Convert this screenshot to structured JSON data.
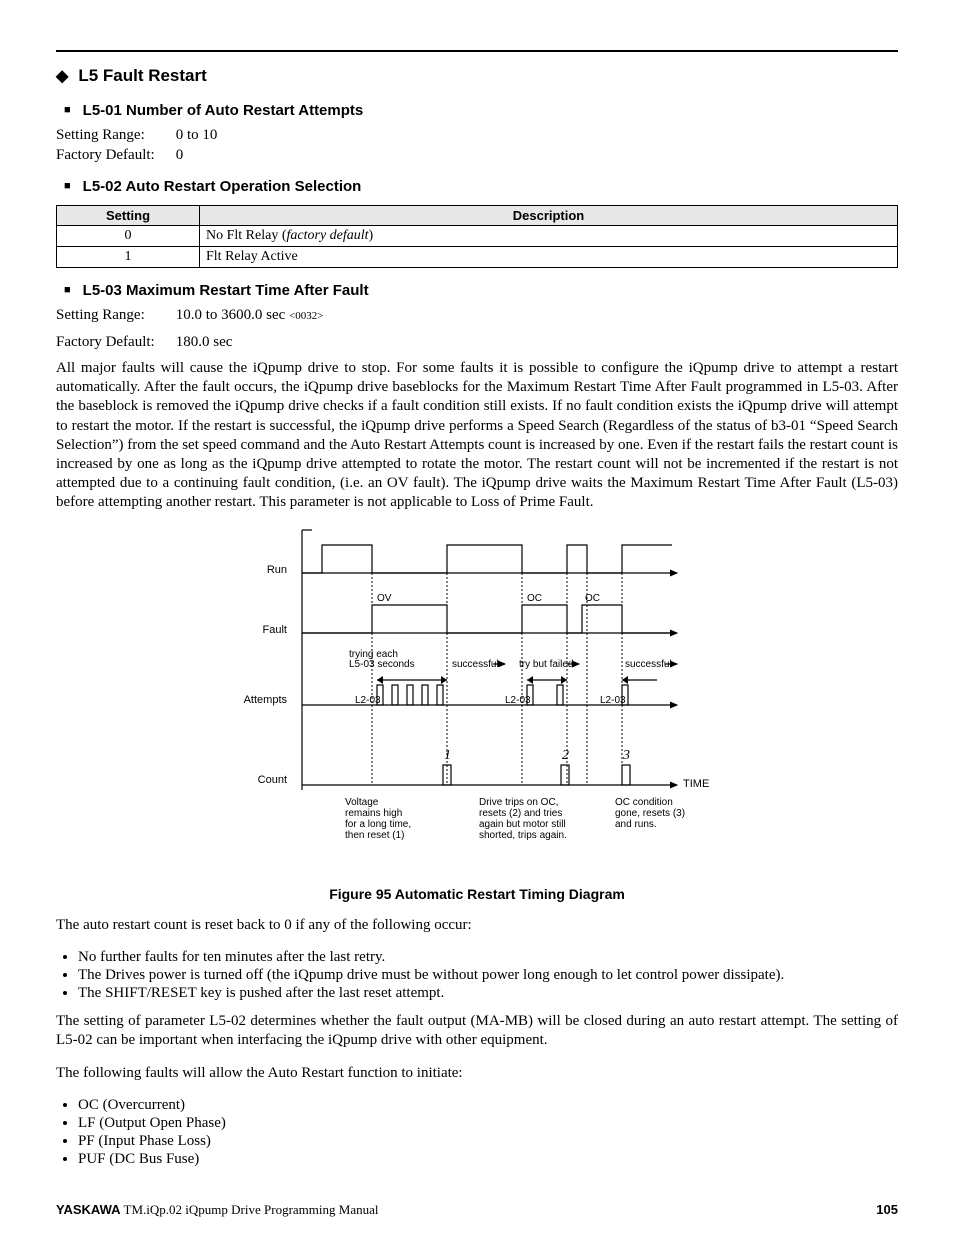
{
  "section_title": "L5 Fault Restart",
  "subsections": {
    "l5_01": {
      "title": "L5-01 Number of Auto Restart Attempts",
      "setting_range_label": "Setting Range:",
      "setting_range_value": "0 to 10",
      "factory_default_label": "Factory Default:",
      "factory_default_value": "0"
    },
    "l5_02": {
      "title": "L5-02 Auto Restart Operation Selection",
      "table": {
        "header": {
          "setting": "Setting",
          "description": "Description"
        },
        "rows": [
          {
            "setting": "0",
            "description": "No Flt Relay (factory default)",
            "desc_prefix": "No Flt Relay (",
            "desc_italic": "factory default",
            "desc_suffix": ")"
          },
          {
            "setting": "1",
            "description": "Flt Relay Active"
          }
        ]
      }
    },
    "l5_03": {
      "title": "L5-03 Maximum Restart Time After Fault",
      "setting_range_label": "Setting Range:",
      "setting_range_value": "10.0 to 3600.0 sec ",
      "setting_range_code": "<0032>",
      "factory_default_label": "Factory Default:",
      "factory_default_value": "180.0 sec",
      "paragraph": "All major faults will cause the iQpump drive to stop. For some faults it is possible to configure the iQpump drive to attempt a restart automatically. After the fault occurs, the iQpump drive baseblocks for the Maximum Restart Time After Fault programmed in L5-03. After the baseblock is removed the iQpump drive checks if a fault condition still exists. If no fault condition exists the iQpump drive will attempt to restart the motor. If the restart is successful, the iQpump drive performs a Speed Search (Regardless of the status of b3-01 “Speed Search Selection”) from the set speed command and the Auto Restart Attempts count is increased by one. Even if the restart fails the restart count is increased by one as long as the iQpump drive attempted to rotate the motor. The restart count will not be incremented if the restart is not attempted due to a continuing fault condition, (i.e. an OV fault). The iQpump drive waits the Maximum Restart Time After Fault (L5-03) before attempting another restart. This parameter is not applicable to Loss of Prime Fault."
    }
  },
  "diagram": {
    "rows": {
      "run": "Run",
      "fault": "Fault",
      "attempts": "Attempts",
      "count": "Count"
    },
    "labels": {
      "ov": "OV",
      "oc1": "OC",
      "oc2": "OC",
      "trying": "trying each\nL5-03 seconds",
      "successful": "successful",
      "try_failed": "try but failed",
      "l203": "L2-03",
      "counts": {
        "c1": "1",
        "c2": "2",
        "c3": "3"
      },
      "time": "TIME",
      "notes": {
        "n1": "Voltage\nremains high\nfor a long time,\nthen reset (1)",
        "n2": "Drive trips on OC,\nresets (2) and tries\nagain but motor still\nshorted, trips again.",
        "n3": "OC condition\ngone, resets (3)\nand runs."
      }
    },
    "caption": "Figure 95  Automatic Restart Timing Diagram"
  },
  "reset_intro": "The auto restart count is reset back to 0 if any of the following occur:",
  "reset_bullets": [
    "No further faults for ten minutes after the last retry.",
    "The Drives power is turned off (the iQpump drive must be without power long enough to let control power dissipate).",
    "The SHIFT/RESET key is pushed after the last reset attempt."
  ],
  "l5_02_para": "The setting of parameter L5-02 determines whether the fault output (MA-MB) will be closed during an auto restart attempt. The setting of L5-02 can be important when interfacing the iQpump drive with other equipment.",
  "faults_intro": "The following faults will allow the Auto Restart function to initiate:",
  "fault_bullets": [
    "OC (Overcurrent)",
    "LF (Output Open Phase)",
    "PF (Input Phase Loss)",
    "PUF (DC Bus Fuse)"
  ],
  "footer": {
    "brand": "YASKAWA",
    "doc": " TM.iQp.02 iQpump Drive Programming Manual",
    "page": "105"
  }
}
